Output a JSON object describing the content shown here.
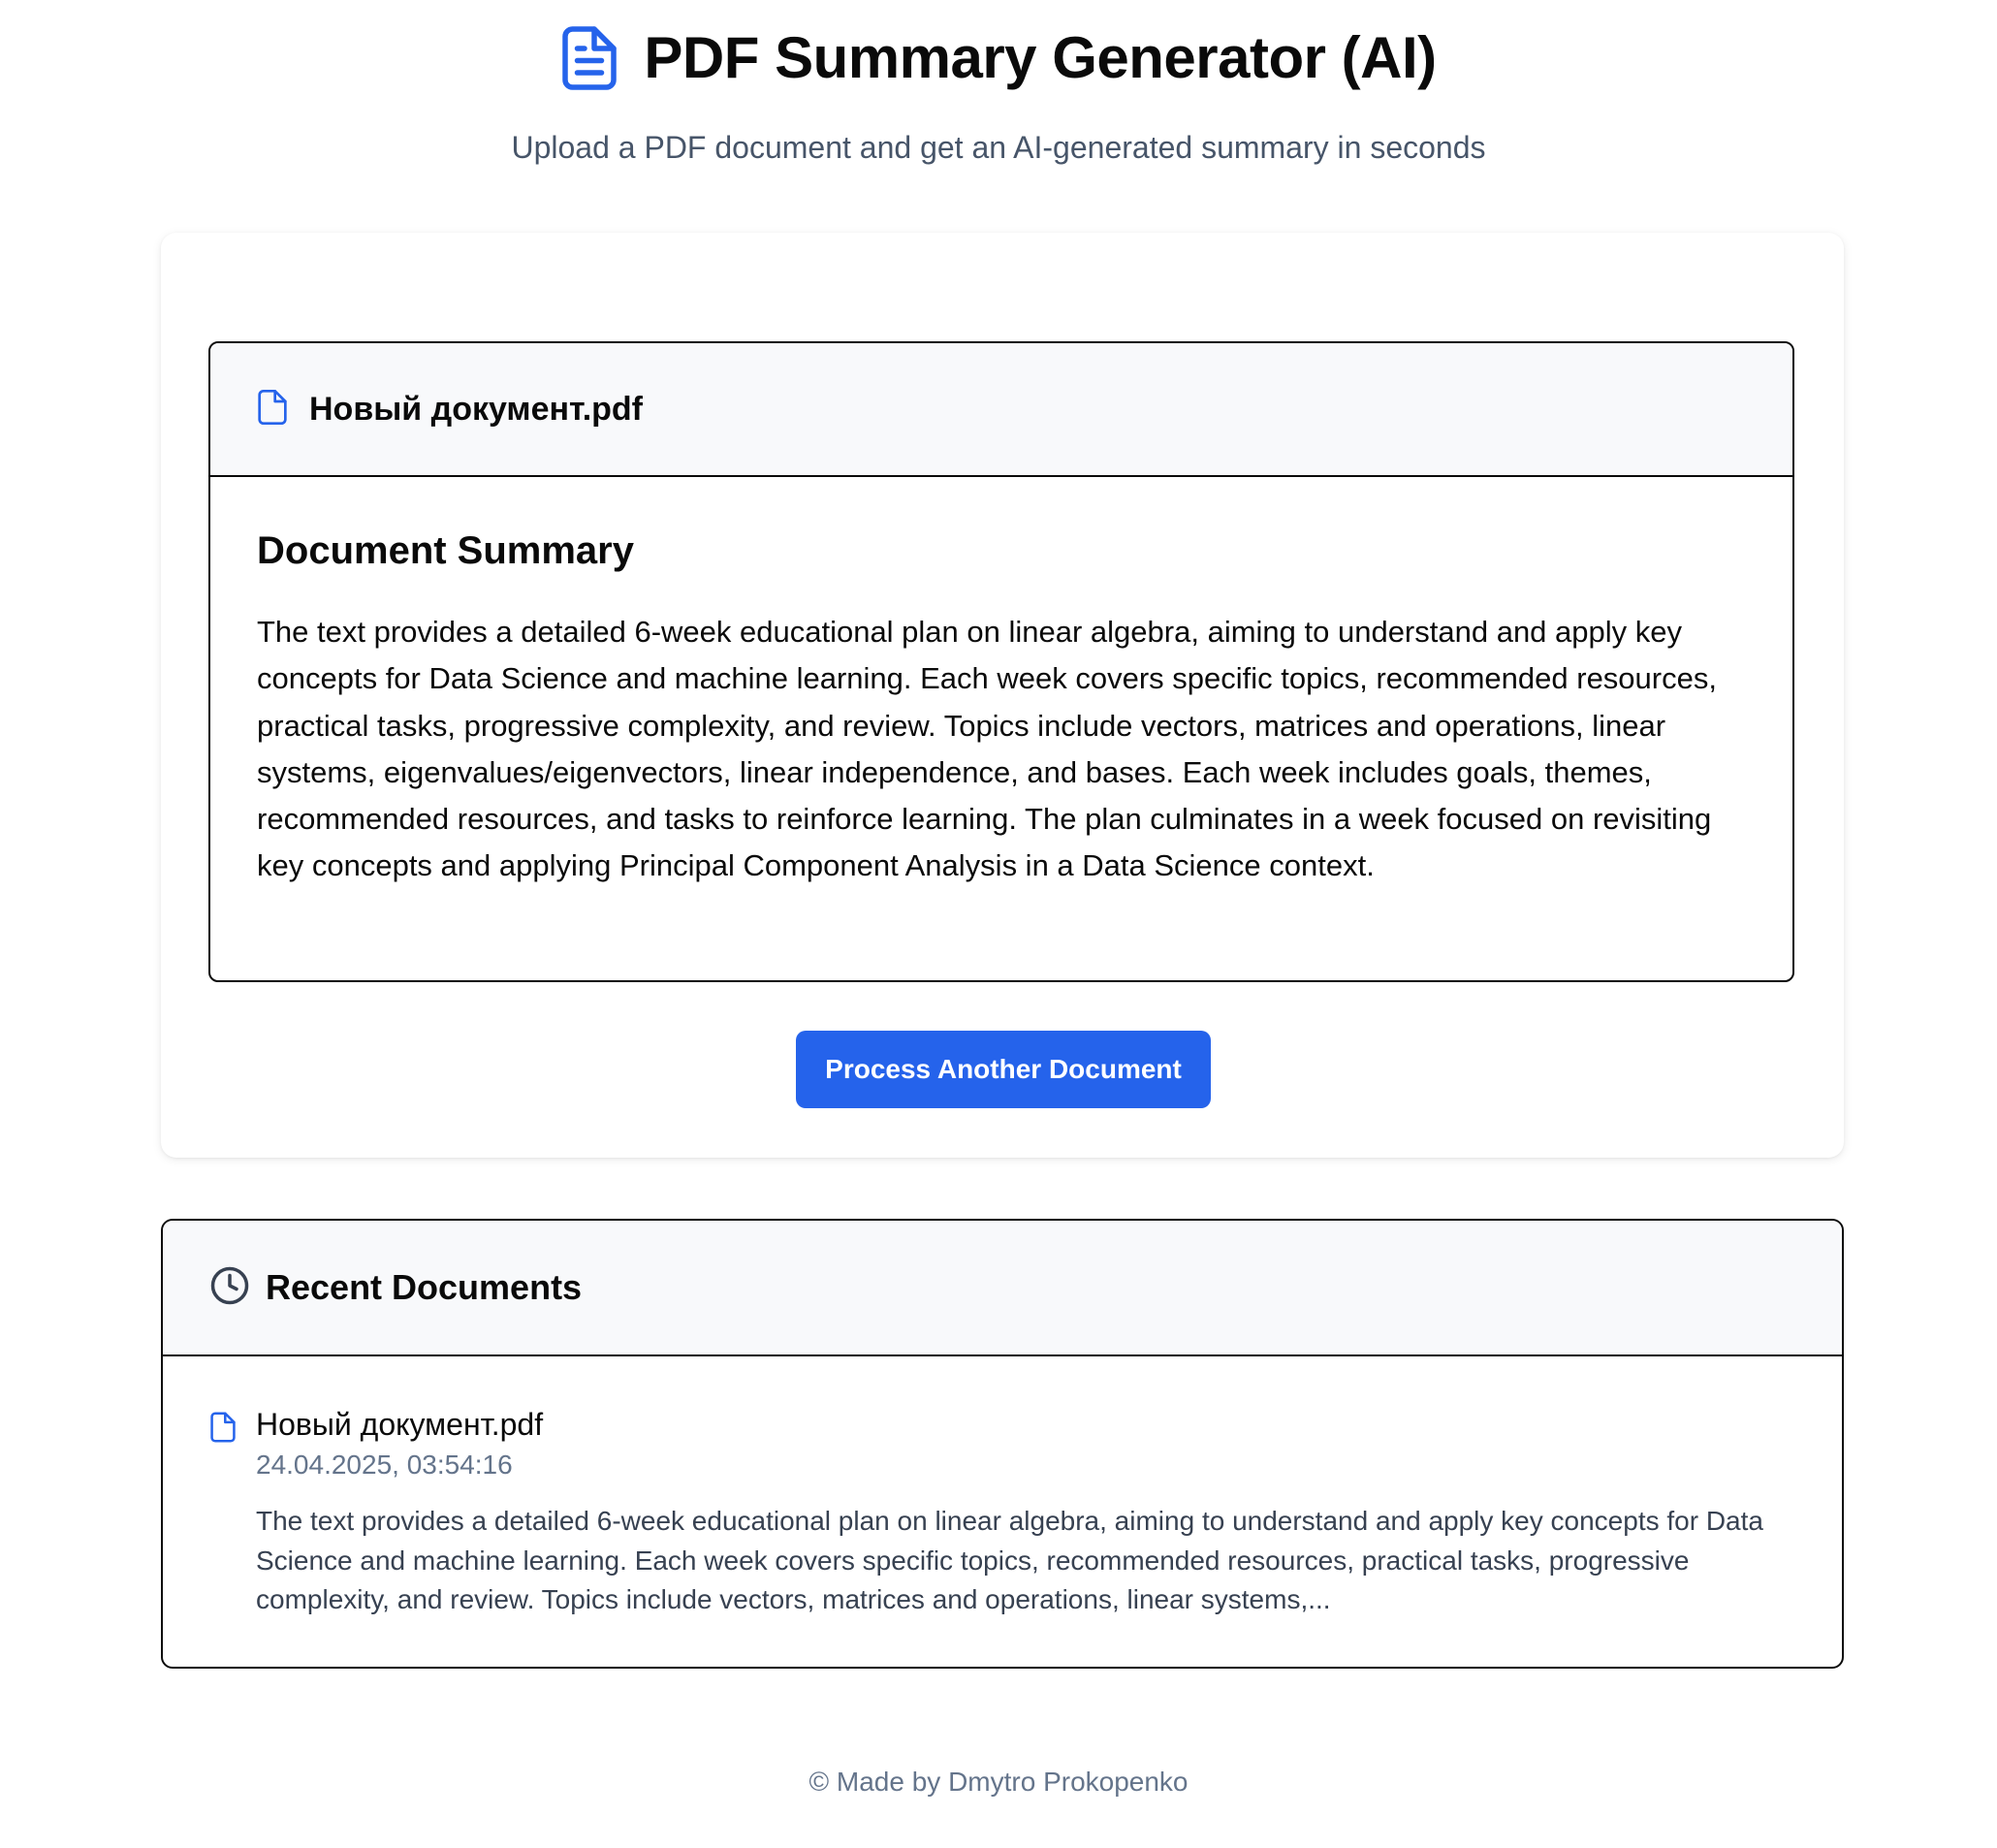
{
  "header": {
    "title": "PDF Summary Generator (AI)",
    "subtitle": "Upload a PDF document and get an AI-generated summary in seconds",
    "icon": "file-text-icon"
  },
  "summary": {
    "file_name": "Новый документ.pdf",
    "file_icon": "file-icon",
    "heading": "Document Summary",
    "text": "The text provides a detailed 6-week educational plan on linear algebra, aiming to understand and apply key concepts for Data Science and machine learning. Each week covers specific topics, recommended resources, practical tasks, progressive complexity, and review. Topics include vectors, matrices and operations, linear systems, eigenvalues/eigenvectors, linear independence, and bases. Each week includes goals, themes, recommended resources, and tasks to reinforce learning. The plan culminates in a week focused on revisiting key concepts and applying Principal Component Analysis in a Data Science context."
  },
  "actions": {
    "process_another_label": "Process Another Document"
  },
  "recent": {
    "title": "Recent Documents",
    "icon": "clock-icon",
    "items": [
      {
        "name": "Новый документ.pdf",
        "date": "24.04.2025, 03:54:16",
        "snippet": "The text provides a detailed 6-week educational plan on linear algebra, aiming to understand and apply key concepts for Data Science and machine learning. Each week covers specific topics, recommended resources, practical tasks, progressive complexity, and review. Topics include vectors, matrices and operations, linear systems,..."
      }
    ]
  },
  "footer": {
    "text": "© Made by Dmytro Prokopenko"
  },
  "colors": {
    "accent": "#2563eb",
    "muted_text": "#64748b",
    "panel_header_bg": "#f8f9fb"
  }
}
